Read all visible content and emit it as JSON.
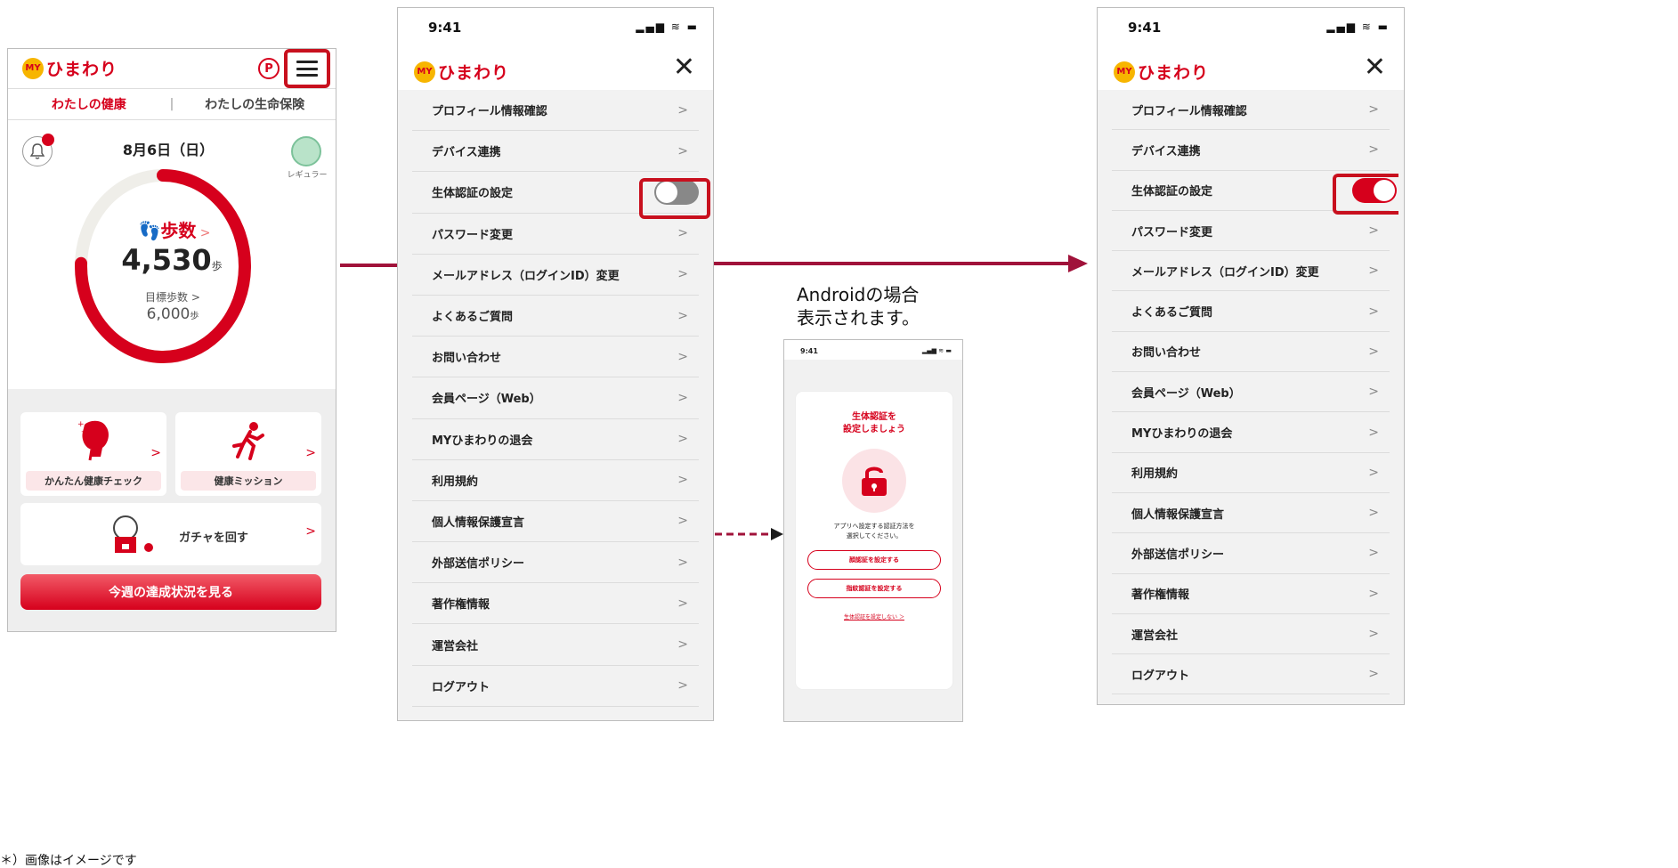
{
  "brand": {
    "logo_mark": "MY",
    "logo_text": "ひまわり",
    "accent_color": "#d6001c"
  },
  "home": {
    "points_badge": "P",
    "tabs": [
      "わたしの健康",
      "わたしの生命保険"
    ],
    "tab_separator": "|",
    "date": "8月6日（日）",
    "member_rank": "レギュラー",
    "steps_label": "歩数",
    "steps_value": "4,530",
    "steps_unit": "歩",
    "goal_label": "目標歩数",
    "goal_value": "6,000",
    "goal_unit": "歩",
    "steps_progress": 0.755,
    "cards": {
      "health_check": "かんたん健康チェック",
      "health_mission": "健康ミッション",
      "gacha": "ガチャを回す"
    },
    "cta_label": "今週の達成状況を見る"
  },
  "settings": {
    "status_time": "9:41",
    "status_icons": "▂▄▆ ≋ ▬",
    "close_icon": "close-icon",
    "items": [
      "プロフィール情報確認",
      "デバイス連携",
      "生体認証の設定",
      "パスワード変更",
      "メールアドレス（ログインID）変更",
      "よくあるご質問",
      "お問い合わせ",
      "会員ページ（Web）",
      "MYひまわりの退会",
      "利用規約",
      "個人情報保護宣言",
      "外部送信ポリシー",
      "著作権情報",
      "運営会社",
      "ログアウト"
    ],
    "chevron": ">",
    "biometric_off_color": "#888888",
    "biometric_on_color": "#d6001c"
  },
  "android": {
    "note_line1": "Androidの場合",
    "note_line2": "表示されます。",
    "status_time": "9:41",
    "title_line1": "生体認証を",
    "title_line2": "設定しましょう",
    "desc_line1": "アプリへ設定する認証方法を",
    "desc_line2": "選択してください。",
    "face_button": "顔認証を設定する",
    "finger_button": "指紋認証を設定する",
    "skip_link": "生体認証を設定しない ＞"
  },
  "footnote": "＊）画像はイメージです"
}
